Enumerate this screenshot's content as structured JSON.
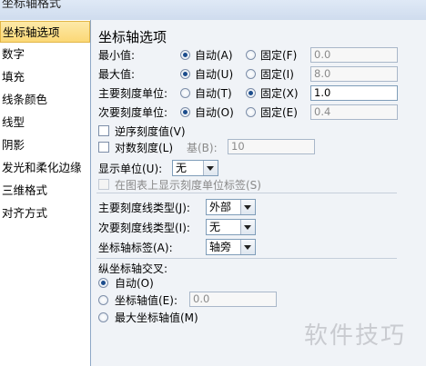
{
  "window": {
    "title": "坐标轴格式"
  },
  "sidebar": {
    "items": [
      {
        "label": "坐标轴选项",
        "active": true
      },
      {
        "label": "数字"
      },
      {
        "label": "填充"
      },
      {
        "label": "线条颜色"
      },
      {
        "label": "线型"
      },
      {
        "label": "阴影"
      },
      {
        "label": "发光和柔化边缘"
      },
      {
        "label": "三维格式"
      },
      {
        "label": "对齐方式"
      }
    ]
  },
  "panel": {
    "heading": "坐标轴选项",
    "rows": {
      "min": {
        "label": "最小值:",
        "auto": "自动(A)",
        "fixed": "固定(F)",
        "value": "0.0",
        "selected": "auto"
      },
      "max": {
        "label": "最大值:",
        "auto": "自动(U)",
        "fixed": "固定(I)",
        "value": "8.0",
        "selected": "auto"
      },
      "major": {
        "label": "主要刻度单位:",
        "auto": "自动(T)",
        "fixed": "固定(X)",
        "value": "1.0",
        "selected": "fixed"
      },
      "minor": {
        "label": "次要刻度单位:",
        "auto": "自动(O)",
        "fixed": "固定(E)",
        "value": "0.4",
        "selected": "auto"
      }
    },
    "reverse": {
      "label": "逆序刻度值(V)",
      "checked": false
    },
    "log": {
      "label": "对数刻度(L)",
      "base_label": "基(B):",
      "base_value": "10",
      "checked": false
    },
    "display_unit": {
      "label": "显示单位(U):",
      "value": "无"
    },
    "show_unit_label": {
      "label": "在图表上显示刻度单位标签(S)",
      "checked": false,
      "disabled": true
    },
    "major_tick_type": {
      "label": "主要刻度线类型(J):",
      "value": "外部"
    },
    "minor_tick_type": {
      "label": "次要刻度线类型(I):",
      "value": "无"
    },
    "axis_labels": {
      "label": "坐标轴标签(A):",
      "value": "轴旁"
    },
    "cross": {
      "title": "纵坐标轴交叉:",
      "auto": "自动(O)",
      "value_label": "坐标轴值(E):",
      "value": "0.0",
      "max_label": "最大坐标轴值(M)",
      "selected": "auto"
    }
  },
  "watermark": "软件技巧"
}
